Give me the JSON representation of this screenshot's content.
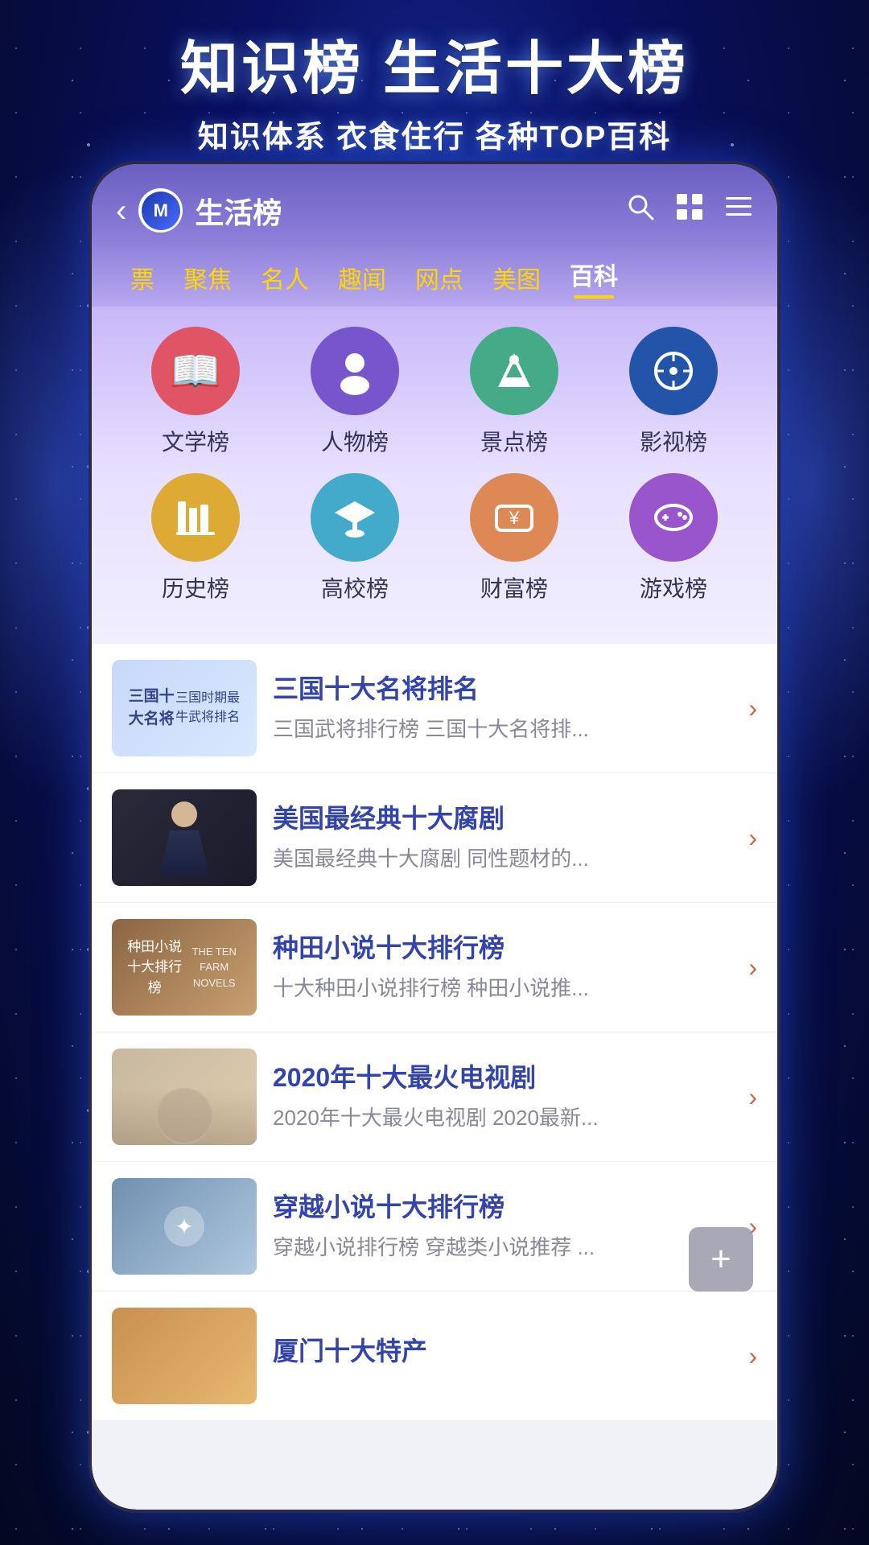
{
  "background": {
    "gradient_from": "#0a1060",
    "gradient_to": "#030820"
  },
  "headline": {
    "title": "知识榜 生活十大榜",
    "subtitle": "知识体系 衣食住行 各种TOP百科"
  },
  "app_header": {
    "back_label": "‹",
    "logo_text": "M",
    "title": "生活榜",
    "search_icon": "search",
    "grid_icon": "grid",
    "menu_icon": "menu"
  },
  "tabs": [
    {
      "label": "票",
      "active": false
    },
    {
      "label": "聚焦",
      "active": false
    },
    {
      "label": "名人",
      "active": false
    },
    {
      "label": "趣闻",
      "active": false
    },
    {
      "label": "网点",
      "active": false
    },
    {
      "label": "美图",
      "active": false
    },
    {
      "label": "百科",
      "active": true
    }
  ],
  "categories": [
    {
      "label": "文学榜",
      "icon": "📖",
      "color": "#e05566",
      "bg": "#e05566"
    },
    {
      "label": "人物榜",
      "icon": "👤",
      "color": "#7755cc",
      "bg": "#7755cc"
    },
    {
      "label": "景点榜",
      "icon": "🏔",
      "color": "#44aa88",
      "bg": "#44aa88"
    },
    {
      "label": "影视榜",
      "icon": "🎬",
      "color": "#2255aa",
      "bg": "#2255aa"
    },
    {
      "label": "历史榜",
      "icon": "📊",
      "color": "#ddaa33",
      "bg": "#ddaa33"
    },
    {
      "label": "高校榜",
      "icon": "🎓",
      "color": "#44aacc",
      "bg": "#44aacc"
    },
    {
      "label": "财富榜",
      "icon": "💴",
      "color": "#dd8855",
      "bg": "#dd8855"
    },
    {
      "label": "游戏榜",
      "icon": "🎮",
      "color": "#9955cc",
      "bg": "#9955cc"
    }
  ],
  "list_items": [
    {
      "title": "三国十大名将排名",
      "desc": "三国武将排行榜 三国十大名将排...",
      "thumb_text": "三国十大名将\n三国时期最牛武将排名",
      "thumb_style": "1"
    },
    {
      "title": "美国最经典十大腐剧",
      "desc": "美国最经典十大腐剧 同性题材的...",
      "thumb_text": "",
      "thumb_style": "2"
    },
    {
      "title": "种田小说十大排行榜",
      "desc": "十大种田小说排行榜 种田小说推...",
      "thumb_text": "种田小说十大排行榜\nTHE TEN FARM NOVELS",
      "thumb_style": "3"
    },
    {
      "title": "2020年十大最火电视剧",
      "desc": "2020年十大最火电视剧 2020最新...",
      "thumb_text": "",
      "thumb_style": "4"
    },
    {
      "title": "穿越小说十大排行榜",
      "desc": "穿越小说排行榜 穿越类小说推荐 ...",
      "thumb_text": "",
      "thumb_style": "5"
    },
    {
      "title": "厦门十大特产",
      "desc": "",
      "thumb_text": "",
      "thumb_style": "6"
    }
  ],
  "fab": {
    "label": "+"
  }
}
